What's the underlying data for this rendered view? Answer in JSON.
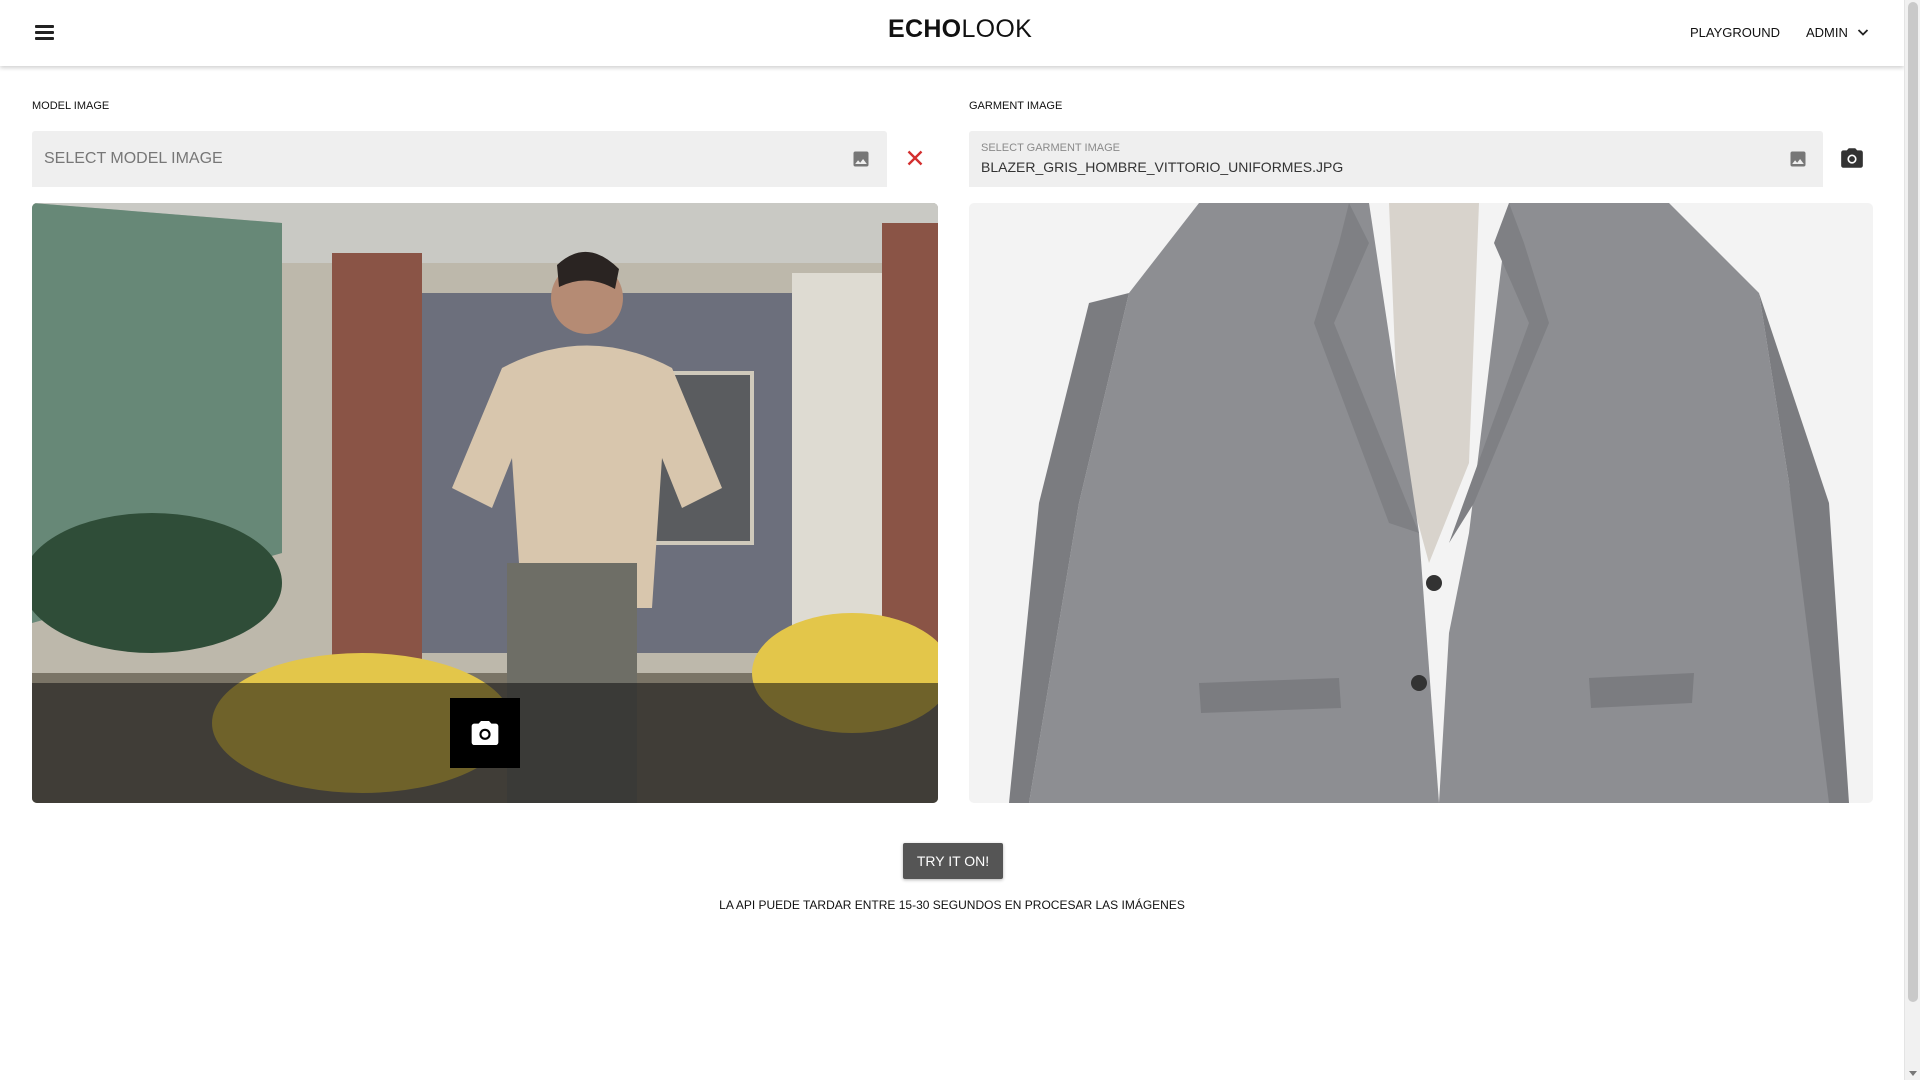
{
  "header": {
    "logo_bold": "ECHO",
    "logo_light": "LOOK",
    "nav": {
      "playground": "PLAYGROUND",
      "admin": "ADMIN"
    }
  },
  "model": {
    "label": "MODEL IMAGE",
    "placeholder": "SELECT MODEL IMAGE"
  },
  "garment": {
    "label": "GARMENT IMAGE",
    "field_label": "SELECT GARMENT IMAGE",
    "value": "BLAZER_GRIS_HOMBRE_VITTORIO_UNIFORMES.JPG"
  },
  "actions": {
    "try_label": "TRY IT ON!",
    "note": "LA API PUEDE TARDAR ENTRE 15-30 SEGUNDOS EN PROCESAR LAS IMÁGENES"
  },
  "colors": {
    "clear_icon": "#d32f2f",
    "button_bg": "#555555",
    "field_bg": "#efefef"
  },
  "icons": [
    "menu-icon",
    "chevron-down-icon",
    "image-icon",
    "close-icon",
    "camera-icon"
  ]
}
